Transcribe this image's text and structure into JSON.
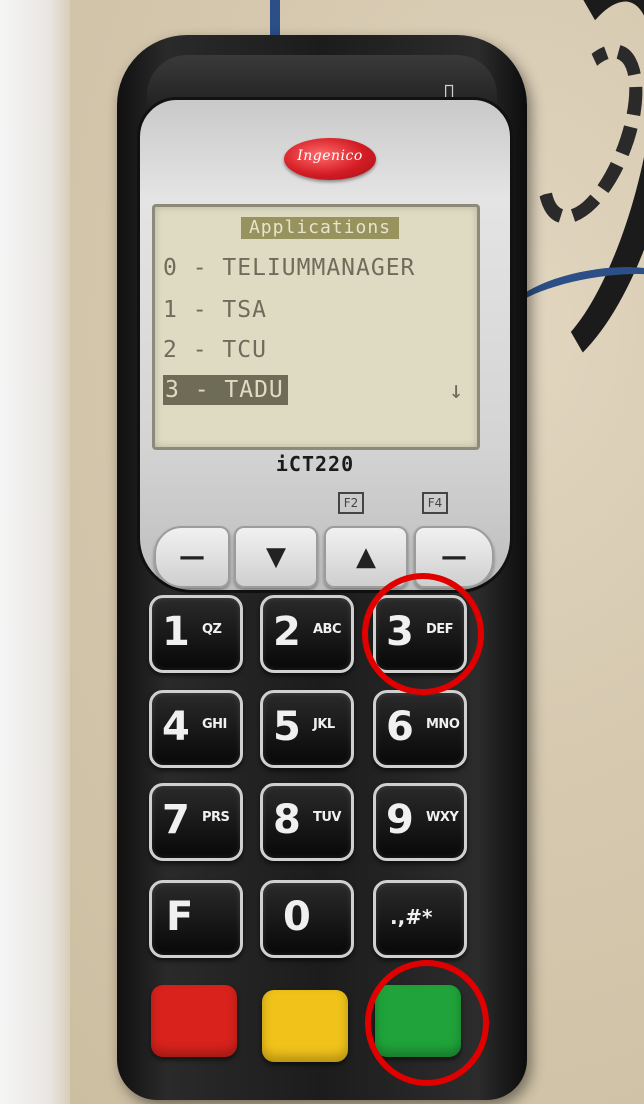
{
  "device": {
    "brand": "Ingenico",
    "model": "iCT220",
    "slot_icon": "card-slot-icon"
  },
  "screen": {
    "title": "Applications",
    "items": [
      {
        "label": "0 - TELIUMMANAGER",
        "selected": false
      },
      {
        "label": "1 - TSA",
        "selected": false
      },
      {
        "label": "2 - TCU",
        "selected": false
      },
      {
        "label": "3 - TADU",
        "selected": true
      }
    ],
    "scroll_icon": "down-arrow-icon",
    "scroll_glyph": "↓"
  },
  "softkeys": {
    "left_icon": "F2",
    "right_icon": "F4"
  },
  "nav_keys": [
    {
      "name": "left-softkey",
      "glyph": "—"
    },
    {
      "name": "down-key",
      "glyph": "▼"
    },
    {
      "name": "up-key",
      "glyph": "▲"
    },
    {
      "name": "right-softkey",
      "glyph": "—"
    }
  ],
  "keypad": [
    {
      "main": "1",
      "sub": "QZ"
    },
    {
      "main": "2",
      "sub": "ABC"
    },
    {
      "main": "3",
      "sub": "DEF"
    },
    {
      "main": "4",
      "sub": "GHI"
    },
    {
      "main": "5",
      "sub": "JKL"
    },
    {
      "main": "6",
      "sub": "MNO"
    },
    {
      "main": "7",
      "sub": "PRS"
    },
    {
      "main": "8",
      "sub": "TUV"
    },
    {
      "main": "9",
      "sub": "WXY"
    },
    {
      "main": "F",
      "sub": ""
    },
    {
      "main": "0",
      "sub": ""
    },
    {
      "main": ".,#*",
      "sub": ""
    }
  ],
  "function_keys": [
    {
      "name": "cancel",
      "color": "#d9221c"
    },
    {
      "name": "correction",
      "color": "#f0c21a"
    },
    {
      "name": "validate",
      "color": "#1fa33a"
    }
  ],
  "highlight_color": "#e00000"
}
